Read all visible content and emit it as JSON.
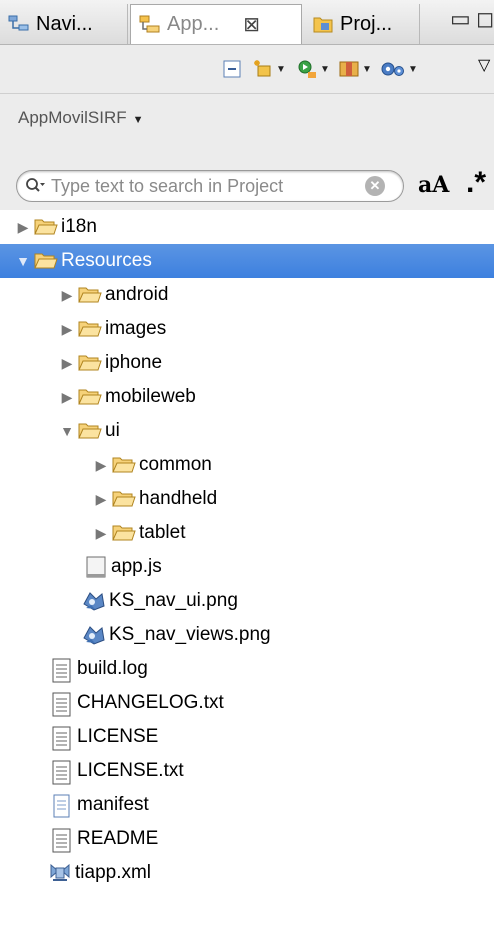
{
  "tabs": [
    {
      "label": "Navi..."
    },
    {
      "label": "App...",
      "close": "⊠"
    },
    {
      "label": "Proj..."
    }
  ],
  "project_selector": {
    "name": "AppMovilSIRF"
  },
  "search": {
    "placeholder": "Type text to search in Project",
    "case_label": "aA",
    "regex_label": ".*"
  },
  "tree": {
    "nodes": [
      {
        "label": "i18n"
      },
      {
        "label": "Resources"
      },
      {
        "label": "android"
      },
      {
        "label": "images"
      },
      {
        "label": "iphone"
      },
      {
        "label": "mobileweb"
      },
      {
        "label": "ui"
      },
      {
        "label": "common"
      },
      {
        "label": "handheld"
      },
      {
        "label": "tablet"
      },
      {
        "label": "app.js"
      },
      {
        "label": "KS_nav_ui.png"
      },
      {
        "label": "KS_nav_views.png"
      },
      {
        "label": "build.log"
      },
      {
        "label": "CHANGELOG.txt"
      },
      {
        "label": "LICENSE"
      },
      {
        "label": "LICENSE.txt"
      },
      {
        "label": "manifest"
      },
      {
        "label": "README"
      },
      {
        "label": "tiapp.xml"
      }
    ]
  },
  "colors": {
    "selection": "#3d80df",
    "folder": "#f2c34a"
  }
}
